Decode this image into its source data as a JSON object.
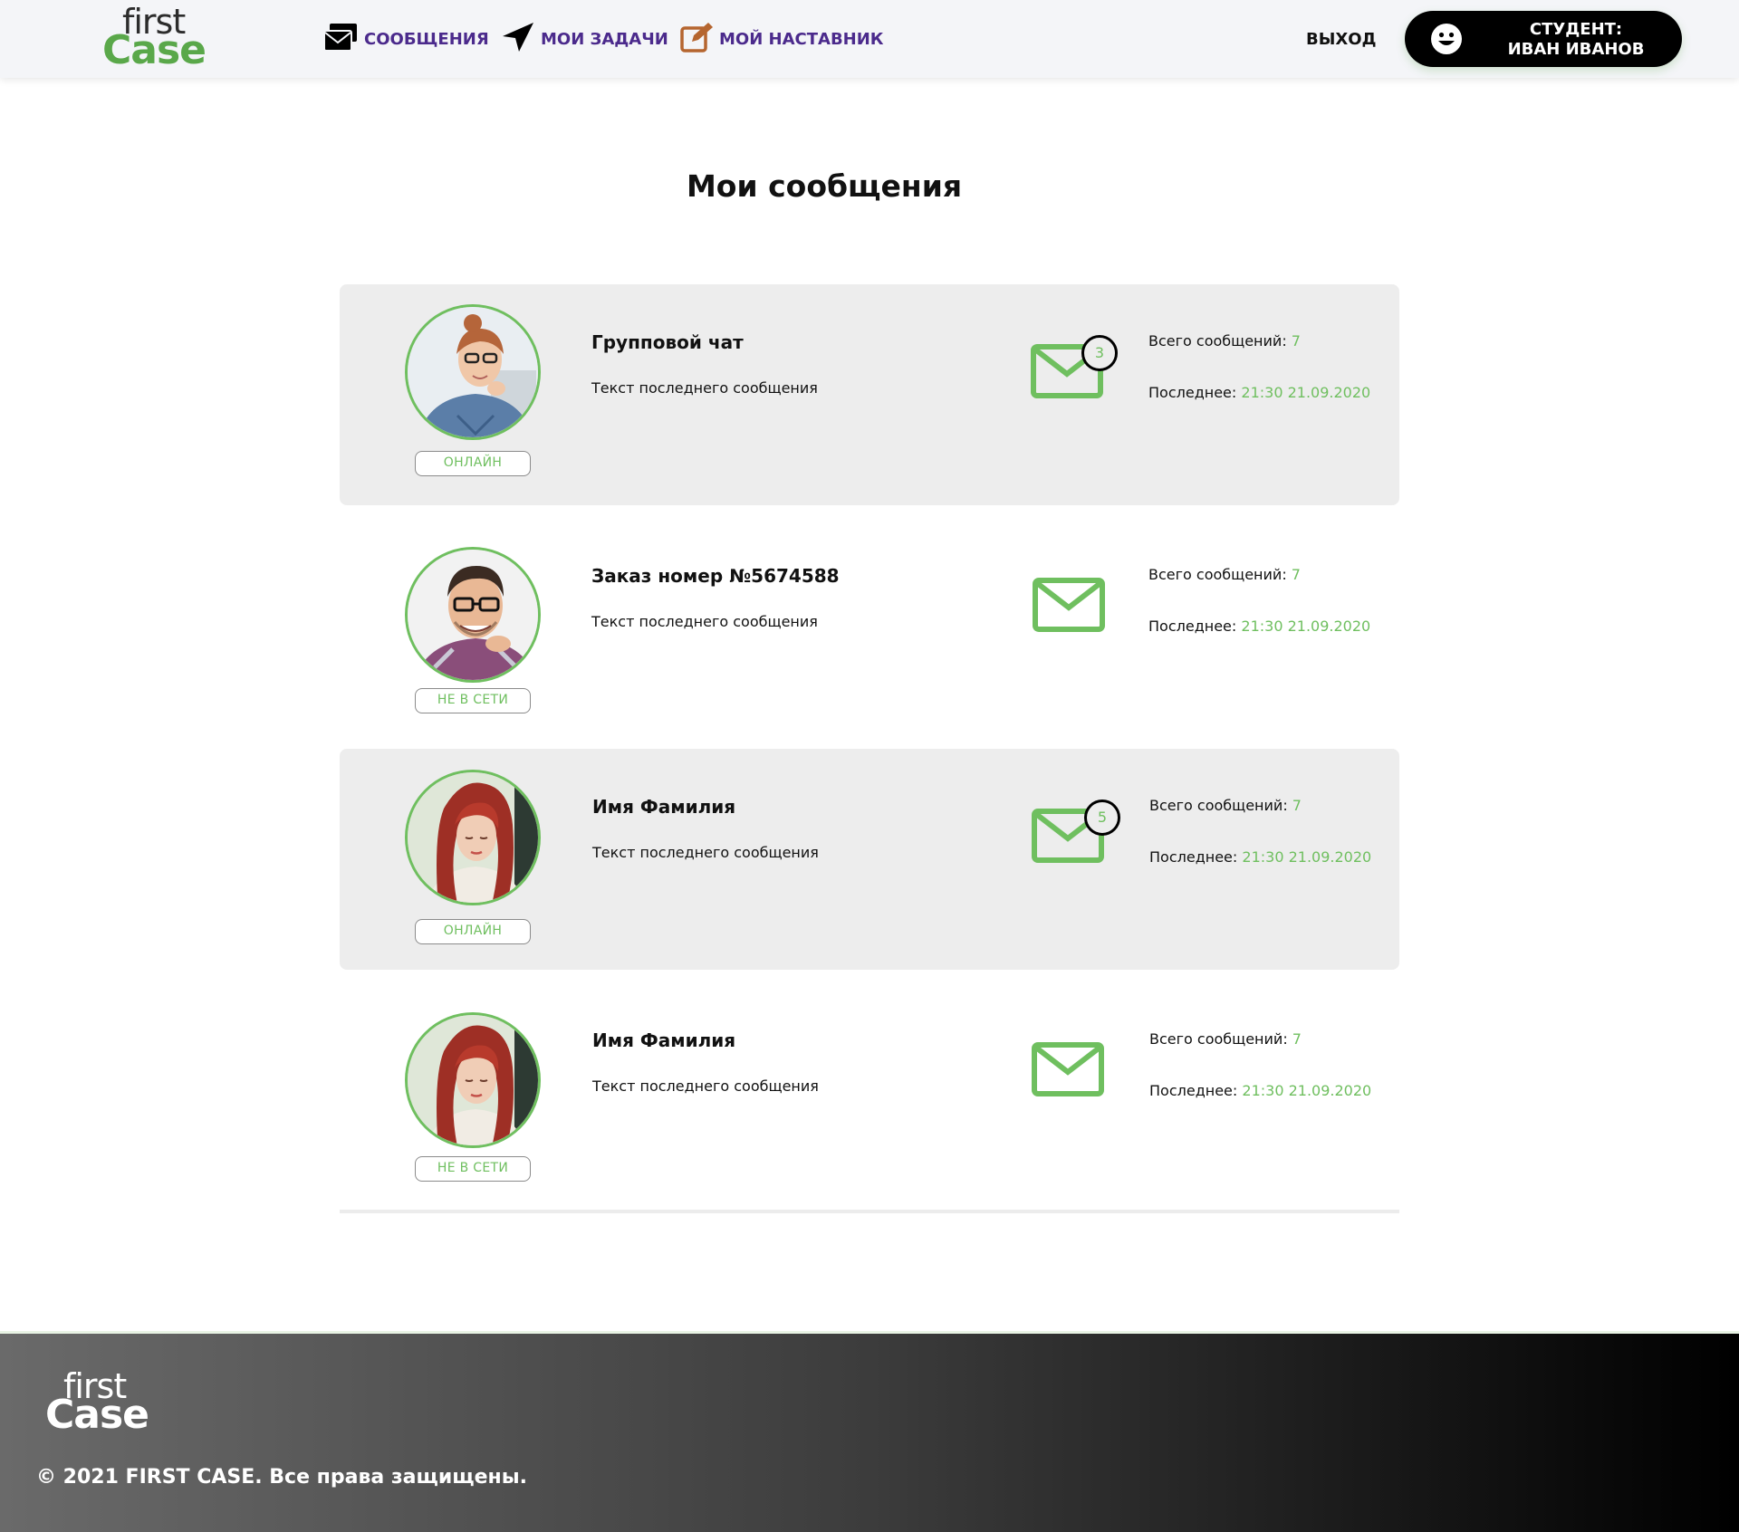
{
  "header": {
    "logo": {
      "first": "first",
      "case": "Case"
    },
    "nav": [
      {
        "label": "СООБЩЕНИЯ",
        "icon": "messages-icon"
      },
      {
        "label": "МОИ ЗАДАЧИ",
        "icon": "paper-plane-icon"
      },
      {
        "label": "МОЙ НАСТАВНИК",
        "icon": "edit-icon"
      }
    ],
    "logout": "ВЫХОД",
    "user": {
      "line1": "СТУДЕНТ:",
      "line2": "ИВАН ИВАНОВ",
      "icon": "smile-icon"
    }
  },
  "main": {
    "title": "Мои сообщения",
    "chats": [
      {
        "name": "Групповой чат",
        "last_message": "Текст последнего сообщения",
        "status": "ОНЛАЙН",
        "unread": "3",
        "total_label": "Всего сообщений:",
        "total": "7",
        "last_label": "Последнее:",
        "last_time": "21:30 21.09.2020"
      },
      {
        "name": "Заказ номер №5674588",
        "last_message": "Текст последнего сообщения",
        "status": "НЕ В СЕТИ",
        "unread": "",
        "total_label": "Всего сообщений:",
        "total": "7",
        "last_label": "Последнее:",
        "last_time": "21:30 21.09.2020"
      },
      {
        "name": "Имя Фамилия",
        "last_message": "Текст последнего сообщения",
        "status": "ОНЛАЙН",
        "unread": "5",
        "total_label": "Всего сообщений:",
        "total": "7",
        "last_label": "Последнее:",
        "last_time": "21:30 21.09.2020"
      },
      {
        "name": "Имя Фамилия",
        "last_message": "Текст последнего сообщения",
        "status": "НЕ В СЕТИ",
        "unread": "",
        "total_label": "Всего сообщений:",
        "total": "7",
        "last_label": "Последнее:",
        "last_time": "21:30 21.09.2020"
      }
    ]
  },
  "footer": {
    "logo": {
      "first": "first",
      "case": "Case"
    },
    "copyright": "© 2021 FIRST CASE. Все права защищены."
  },
  "colors": {
    "accent": "#6fbf5f",
    "nav": "#4b2a8c",
    "row_bg": "#ededed",
    "edit_icon": "#b5652f"
  }
}
